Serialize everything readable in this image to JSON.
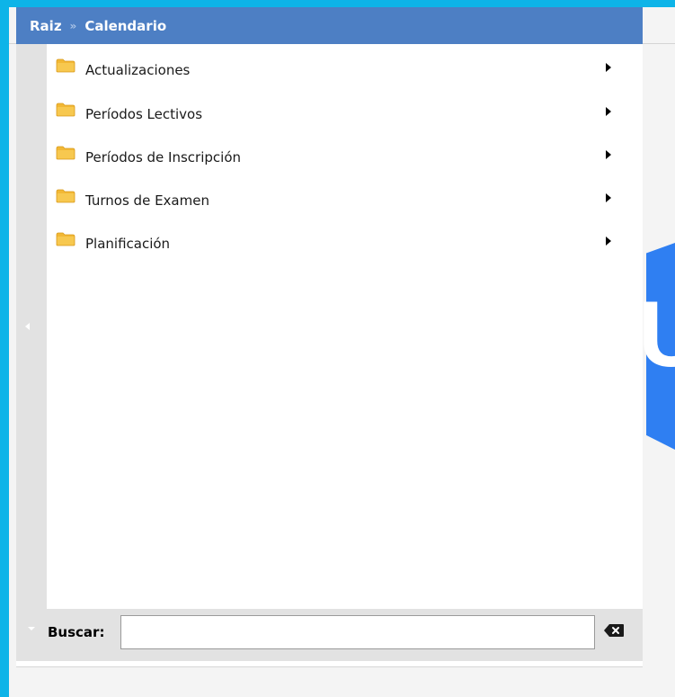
{
  "breadcrumb": {
    "root": "Raiz",
    "separator": "»",
    "current": "Calendario"
  },
  "menu": {
    "items": [
      {
        "label": "Actualizaciones",
        "icon": "folder-icon",
        "has_submenu": true
      },
      {
        "label": "Períodos Lectivos",
        "icon": "folder-icon",
        "has_submenu": true
      },
      {
        "label": "Períodos de Inscripción",
        "icon": "folder-icon",
        "has_submenu": true
      },
      {
        "label": "Turnos de Examen",
        "icon": "folder-icon",
        "has_submenu": true
      },
      {
        "label": "Planificación",
        "icon": "folder-icon",
        "has_submenu": true
      }
    ]
  },
  "search": {
    "label": "Buscar:",
    "value": "",
    "placeholder": "",
    "clear_icon": "backspace-clear-icon"
  },
  "background": {
    "logo_letter": "U"
  },
  "colors": {
    "outer_background": "#0db4e8",
    "breadcrumb_bar": "#4d7fc4",
    "folder": "#f2b835",
    "logo_blue": "#2f7ff2"
  }
}
